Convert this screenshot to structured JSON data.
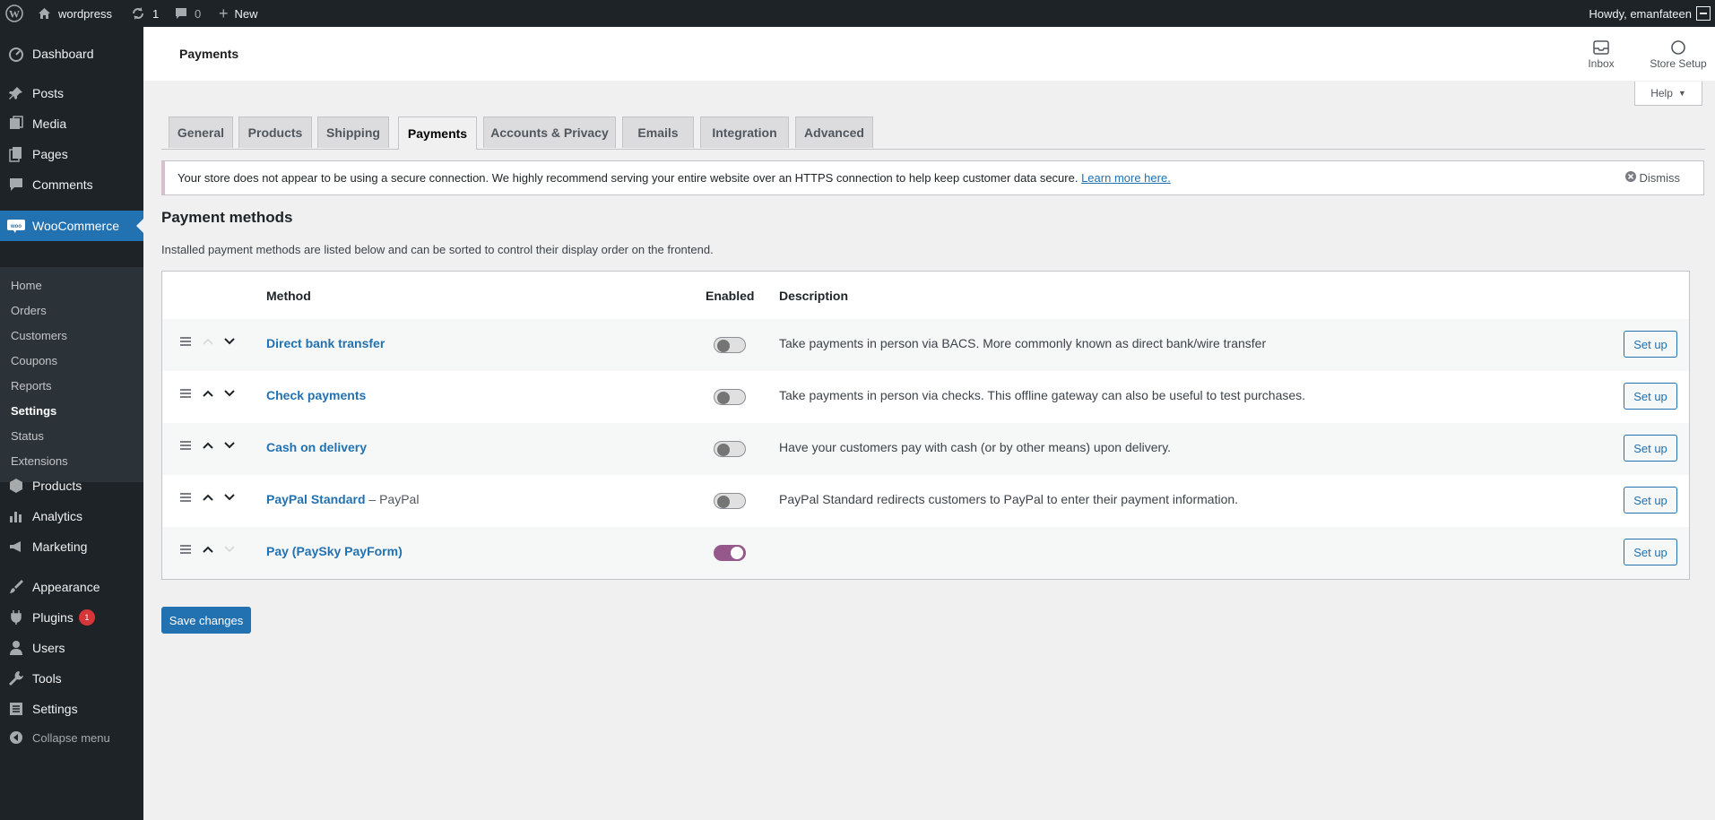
{
  "adminbar": {
    "site_name": "wordpress",
    "updates_count": "1",
    "comments_count": "0",
    "new_label": "New",
    "howdy": "Howdy, emanfateen"
  },
  "sidebar": {
    "top": [
      {
        "label": "Dashboard",
        "icon": "dashboard-icon"
      },
      {
        "label": "Posts",
        "icon": "pin-icon"
      },
      {
        "label": "Media",
        "icon": "media-icon"
      },
      {
        "label": "Pages",
        "icon": "pages-icon"
      },
      {
        "label": "Comments",
        "icon": "comment-icon"
      },
      {
        "label": "WooCommerce",
        "icon": "woo-icon"
      }
    ],
    "woo_submenu": [
      "Home",
      "Orders",
      "Customers",
      "Coupons",
      "Reports",
      "Settings",
      "Status",
      "Extensions"
    ],
    "bottom": [
      {
        "label": "Products",
        "icon": "box-icon"
      },
      {
        "label": "Analytics",
        "icon": "chart-icon"
      },
      {
        "label": "Marketing",
        "icon": "megaphone-icon"
      },
      {
        "label": "Appearance",
        "icon": "brush-icon"
      },
      {
        "label": "Plugins",
        "icon": "plug-icon",
        "badge": "1"
      },
      {
        "label": "Users",
        "icon": "user-icon"
      },
      {
        "label": "Tools",
        "icon": "wrench-icon"
      },
      {
        "label": "Settings",
        "icon": "settings-icon"
      },
      {
        "label": "Collapse menu",
        "icon": "collapse-icon"
      }
    ]
  },
  "header": {
    "title": "Payments",
    "inbox_label": "Inbox",
    "store_setup_label": "Store Setup"
  },
  "help_label": "Help",
  "tabs": [
    "General",
    "Products",
    "Shipping",
    "Payments",
    "Accounts & Privacy",
    "Emails",
    "Integration",
    "Advanced"
  ],
  "active_tab": "Payments",
  "notice": {
    "text": "Your store does not appear to be using a secure connection. We highly recommend serving your entire website over an HTTPS connection to help keep customer data secure.",
    "link": "Learn more here.",
    "dismiss": "Dismiss"
  },
  "section": {
    "title": "Payment methods",
    "description": "Installed payment methods are listed below and can be sorted to control their display order on the frontend."
  },
  "table": {
    "headers": {
      "method": "Method",
      "enabled": "Enabled",
      "description": "Description"
    },
    "rows": [
      {
        "name": "Direct bank transfer",
        "suffix": "",
        "enabled": false,
        "description": "Take payments in person via BACS. More commonly known as direct bank/wire transfer",
        "action": "Set up"
      },
      {
        "name": "Check payments",
        "suffix": "",
        "enabled": false,
        "description": "Take payments in person via checks. This offline gateway can also be useful to test purchases.",
        "action": "Set up"
      },
      {
        "name": "Cash on delivery",
        "suffix": "",
        "enabled": false,
        "description": "Have your customers pay with cash (or by other means) upon delivery.",
        "action": "Set up"
      },
      {
        "name": "PayPal Standard",
        "suffix": " – PayPal",
        "enabled": false,
        "description": "PayPal Standard redirects customers to PayPal to enter their payment information.",
        "action": "Set up"
      },
      {
        "name": "Pay (PaySky PayForm)",
        "suffix": "",
        "enabled": true,
        "description": "",
        "action": "Set up"
      }
    ]
  },
  "save_label": "Save changes",
  "colors": {
    "accent": "#2271b1",
    "toggle_on": "#96588a",
    "admin_dark": "#1d2327"
  }
}
